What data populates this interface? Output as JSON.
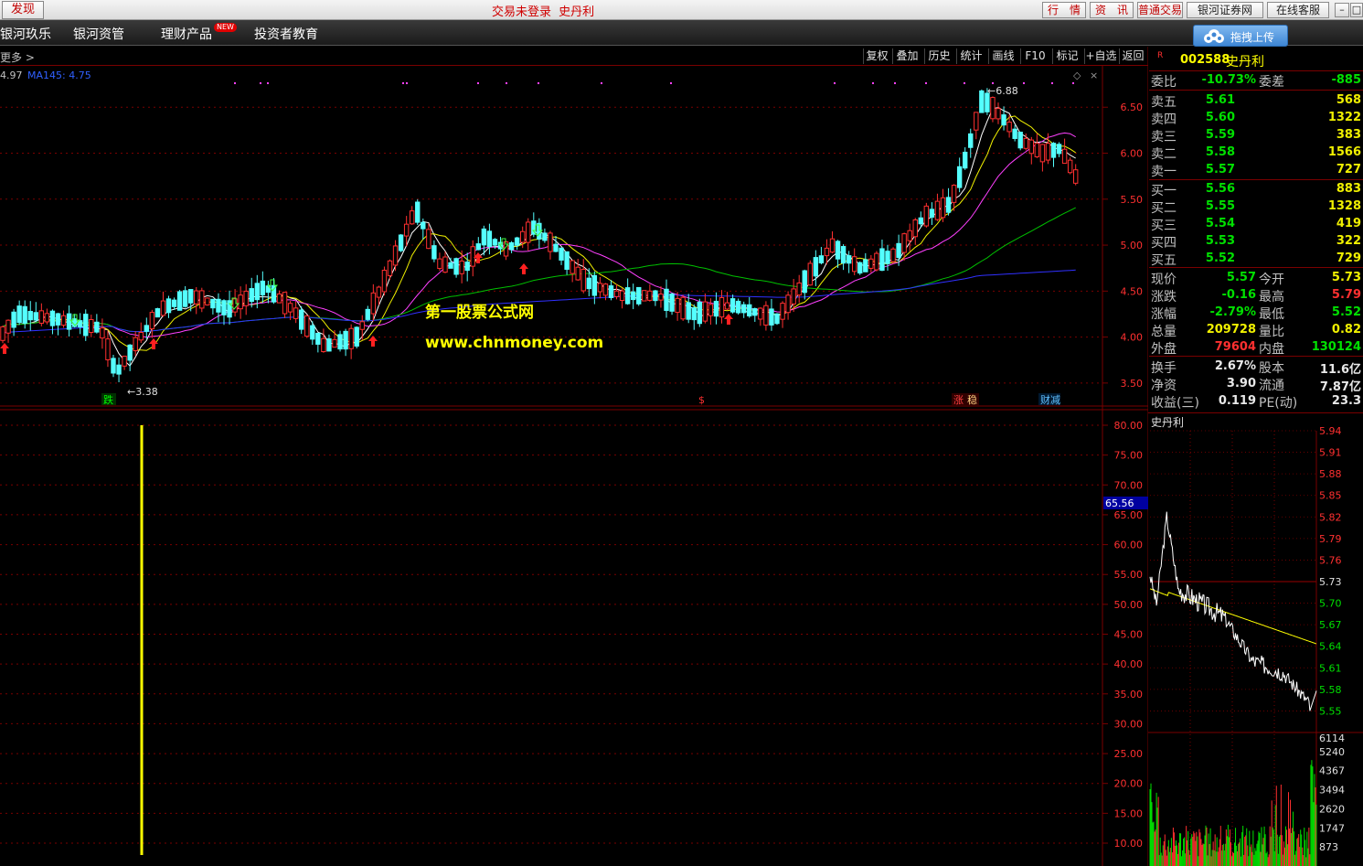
{
  "titlebar": {
    "find": "发现",
    "status": "交易未登录",
    "stock_name": "史丹利",
    "buttons": [
      "行　情",
      "资　讯",
      "普通交易",
      "银河证券网",
      "在线客服"
    ],
    "window_controls": [
      "–",
      "□"
    ]
  },
  "menu": {
    "items": [
      "银河玖乐",
      "银河资管",
      "理财产品",
      "投资者教育"
    ],
    "new_badge": "NEW",
    "upload": "拖拽上传"
  },
  "toolbar": {
    "more": "更多 >",
    "buttons": [
      "复权",
      "叠加",
      "历史",
      "统计",
      "画线",
      "F10",
      "标记",
      "+自选",
      "返回"
    ]
  },
  "kchart": {
    "ma_label_left": "4.97",
    "ma_label": "MA145: 4.75",
    "y_ticks": [
      "6.50",
      "6.00",
      "5.50",
      "5.00",
      "4.50",
      "4.00",
      "3.50"
    ],
    "low_label": "3.38",
    "high_label": "6.88",
    "watermark1": "第一股票公式网",
    "watermark2": "www.chnmoney.com",
    "markers": [
      "跌",
      "$",
      "涨",
      "稳",
      "财减"
    ]
  },
  "indicator": {
    "y_ticks": [
      "80.00",
      "75.00",
      "70.00",
      "65.00",
      "60.00",
      "55.00",
      "50.00",
      "45.00",
      "40.00",
      "35.00",
      "30.00",
      "25.00",
      "20.00",
      "15.00",
      "10.00"
    ],
    "current_value": "65.56"
  },
  "quote": {
    "flag": "R",
    "code": "002588",
    "name": "史丹利",
    "weibi_label": "委比",
    "weibi": "-10.73%",
    "weicha_label": "委差",
    "weicha": "-885",
    "sells": [
      {
        "label": "卖五",
        "price": "5.61",
        "vol": "568"
      },
      {
        "label": "卖四",
        "price": "5.60",
        "vol": "1322"
      },
      {
        "label": "卖三",
        "price": "5.59",
        "vol": "383"
      },
      {
        "label": "卖二",
        "price": "5.58",
        "vol": "1566"
      },
      {
        "label": "卖一",
        "price": "5.57",
        "vol": "727"
      }
    ],
    "buys": [
      {
        "label": "买一",
        "price": "5.56",
        "vol": "883"
      },
      {
        "label": "买二",
        "price": "5.55",
        "vol": "1328"
      },
      {
        "label": "买三",
        "price": "5.54",
        "vol": "419"
      },
      {
        "label": "买四",
        "price": "5.53",
        "vol": "322"
      },
      {
        "label": "买五",
        "price": "5.52",
        "vol": "729"
      }
    ],
    "stats": [
      {
        "l1": "现价",
        "v1": "5.57",
        "l2": "今开",
        "v2": "5.73"
      },
      {
        "l1": "涨跌",
        "v1": "-0.16",
        "l2": "最高",
        "v2": "5.79"
      },
      {
        "l1": "涨幅",
        "v1": "-2.79%",
        "l2": "最低",
        "v2": "5.52"
      },
      {
        "l1": "总量",
        "v1": "209728",
        "l2": "量比",
        "v2": "0.82"
      },
      {
        "l1": "外盘",
        "v1": "79604",
        "l2": "内盘",
        "v2": "130124"
      }
    ],
    "stats2": [
      {
        "l1": "换手",
        "v1": "2.67%",
        "l2": "股本",
        "v2": "11.6亿"
      },
      {
        "l1": "净资",
        "v1": "3.90",
        "l2": "流通",
        "v2": "7.87亿"
      },
      {
        "l1": "收益(三)",
        "v1": "0.119",
        "l2": "PE(动)",
        "v2": "23.3"
      }
    ]
  },
  "intraday": {
    "title": "史丹利",
    "price_ticks": [
      "5.94",
      "5.91",
      "5.88",
      "5.85",
      "5.82",
      "5.79",
      "5.76",
      "5.73",
      "5.70",
      "5.67",
      "5.64",
      "5.61",
      "5.58",
      "5.55"
    ],
    "vol_ticks": [
      "6114",
      "5240",
      "4367",
      "3494",
      "2620",
      "1747",
      "873"
    ]
  },
  "colors": {
    "up": "#ff3030",
    "down": "#54ffff",
    "ma5": "#ffffff",
    "ma10": "#f0f000",
    "ma20": "#ff40ff",
    "ma60": "#00c000",
    "ma145": "#3030ff",
    "grid": "#7a0000"
  }
}
